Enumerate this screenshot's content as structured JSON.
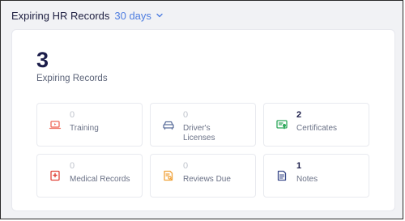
{
  "header": {
    "title": "Expiring HR Records",
    "period": "30 days"
  },
  "summary": {
    "count": "3",
    "label": "Expiring Records"
  },
  "tiles": [
    {
      "count": "0",
      "label": "Training",
      "icon": "laptop-icon",
      "color": "#ef6b5b"
    },
    {
      "count": "0",
      "label": "Driver's\nLicenses",
      "icon": "car-icon",
      "color": "#5c6f9c"
    },
    {
      "count": "2",
      "label": "Certificates",
      "icon": "certificate-icon",
      "color": "#2ca85a"
    },
    {
      "count": "0",
      "label": "Medical Records",
      "icon": "medical-kit-icon",
      "color": "#e0443a"
    },
    {
      "count": "0",
      "label": "Reviews Due",
      "icon": "review-document-icon",
      "color": "#f0a23a"
    },
    {
      "count": "1",
      "label": "Notes",
      "icon": "note-icon",
      "color": "#3a4a8a"
    }
  ]
}
